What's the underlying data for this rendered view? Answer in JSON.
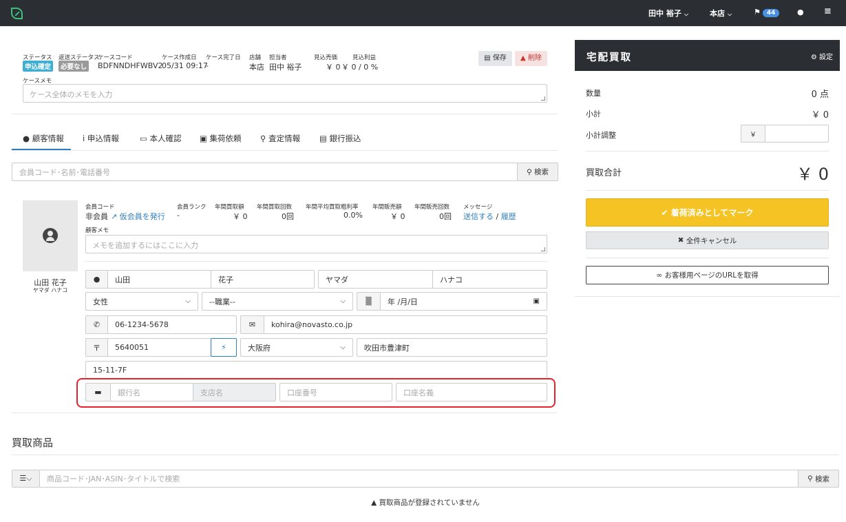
{
  "topnav": {
    "user": "田中 裕子",
    "store": "本店",
    "flag_count": "44",
    "colors": {
      "bg": "#2b2e33",
      "accent": "#3dbf80",
      "badge": "#4a90e2"
    }
  },
  "case": {
    "status_label": "ステータス",
    "status_value": "申込確定",
    "return_status_label": "返送ステータス",
    "return_status_value": "必要なし",
    "code_label": "ケースコード",
    "code_value": "BDFNNDHFWBV2",
    "created_label": "ケース作成日",
    "created_value": "05/31 09:17",
    "completed_label": "ケース完了日",
    "completed_value": "-",
    "store_label": "店舗",
    "store_value": "本店",
    "staff_label": "担当者",
    "staff_value": "田中 裕子",
    "expected_sales_label": "見込売価",
    "expected_sales_value": "￥ 0",
    "expected_profit_label": "見込利益",
    "expected_profit_value": "￥ 0 / 0 %",
    "save_label": "保存",
    "delete_label": "削除",
    "memo_label": "ケースメモ",
    "memo_placeholder": "ケース全体のメモを入力"
  },
  "tabs": [
    {
      "label": "顧客情報",
      "icon": "user-icon"
    },
    {
      "label": "申込情報",
      "icon": "info-icon"
    },
    {
      "label": "本人確認",
      "icon": "id-card-icon"
    },
    {
      "label": "集荷依頼",
      "icon": "truck-icon"
    },
    {
      "label": "査定情報",
      "icon": "search-icon"
    },
    {
      "label": "銀行振込",
      "icon": "money-icon"
    }
  ],
  "member_search": {
    "placeholder": "会員コード･名前･電話番号",
    "button": "検索"
  },
  "customer": {
    "member_code_label": "会員コード",
    "member_code_value": "非会員",
    "issue_link": "仮会員を発行",
    "rank_label": "会員ランク",
    "rank_value": "-",
    "annual_buy_amount_label": "年間買取額",
    "annual_buy_amount_value": "￥ 0",
    "annual_buy_count_label": "年間買取回数",
    "annual_buy_count_value": "0回",
    "annual_margin_label": "年間平均買取粗利率",
    "annual_margin_value": "0.0%",
    "annual_sales_amount_label": "年間販売額",
    "annual_sales_amount_value": "￥ 0",
    "annual_sales_count_label": "年間販売回数",
    "annual_sales_count_value": "0回",
    "message_label": "メッセージ",
    "message_send": "送信する",
    "message_sep": "/",
    "message_history": "履歴",
    "memo_label": "顧客メモ",
    "memo_placeholder": "メモを追加するにはここに入力",
    "name": "山田 花子",
    "name_kana": "ヤマダ ハナコ",
    "last_name": "山田",
    "first_name": "花子",
    "last_kana": "ヤマダ",
    "first_kana": "ハナコ",
    "gender": "女性",
    "job": "--職業--",
    "birthday": "年 /月/日",
    "phone": "06-1234-5678",
    "email": "kohira@novasto.co.jp",
    "zip_mark": "〒",
    "zip": "5640051",
    "prefecture": "大阪府",
    "city": "吹田市豊津町",
    "address": "15-11-7F",
    "bank_placeholder": "銀行名",
    "branch_placeholder": "支店名",
    "account_no_placeholder": "口座番号",
    "account_name_placeholder": "口座名義"
  },
  "products": {
    "title": "買取商品",
    "search_placeholder": "商品コード･JAN･ASIN･タイトルで検索",
    "search_button": "検索",
    "empty_message": "買取商品が登録されていません"
  },
  "panel": {
    "title": "宅配買取",
    "settings": "設定",
    "qty_label": "数量",
    "qty_value": "0 点",
    "subtotal_label": "小計",
    "subtotal_value": "￥ 0",
    "adjust_label": "小計調整",
    "yen": "￥",
    "total_label": "買取合計",
    "total_value": "￥ 0",
    "mark_button": "着荷済みとしてマーク",
    "cancel_button": "全件キャンセル",
    "url_button": "お客様用ページのURLを取得",
    "colors": {
      "yellow": "#f6c324"
    }
  }
}
